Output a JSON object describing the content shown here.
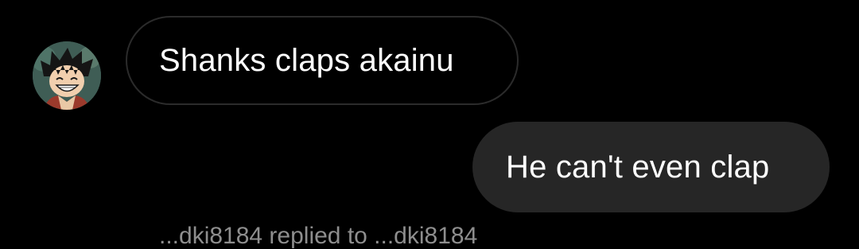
{
  "conversation": {
    "messages": [
      {
        "sender": "other",
        "avatar_icon": "anime-character-avatar-icon",
        "text": "Shanks claps akainu"
      },
      {
        "sender": "self",
        "text": "He can't even clap"
      }
    ],
    "reply_hint": "...dki8184 replied to ...dki8184"
  },
  "colors": {
    "background": "#000000",
    "incoming_bubble_border": "#2b2b2b",
    "outgoing_bubble_fill": "#262626",
    "text": "#ffffff",
    "muted_text": "#8e8e8e"
  }
}
